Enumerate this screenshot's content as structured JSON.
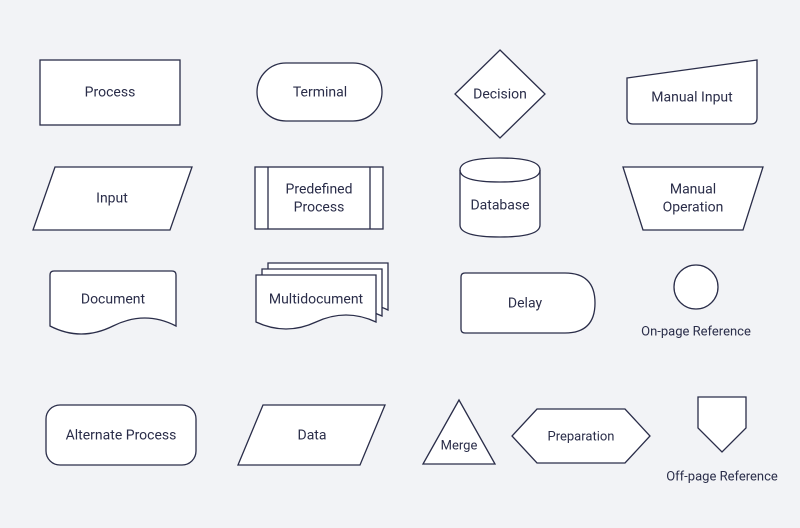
{
  "shapes": {
    "process": "Process",
    "terminal": "Terminal",
    "decision": "Decision",
    "manualInput": "Manual Input",
    "input": "Input",
    "predefinedProcess1": "Predefined",
    "predefinedProcess2": "Process",
    "database": "Database",
    "manualOperation1": "Manual",
    "manualOperation2": "Operation",
    "document": "Document",
    "multidocument": "Multidocument",
    "delay": "Delay",
    "onPageReference": "On-page Reference",
    "alternateProcess": "Alternate Process",
    "data": "Data",
    "merge": "Merge",
    "preparation": "Preparation",
    "offPageReference": "Off-page Reference"
  }
}
